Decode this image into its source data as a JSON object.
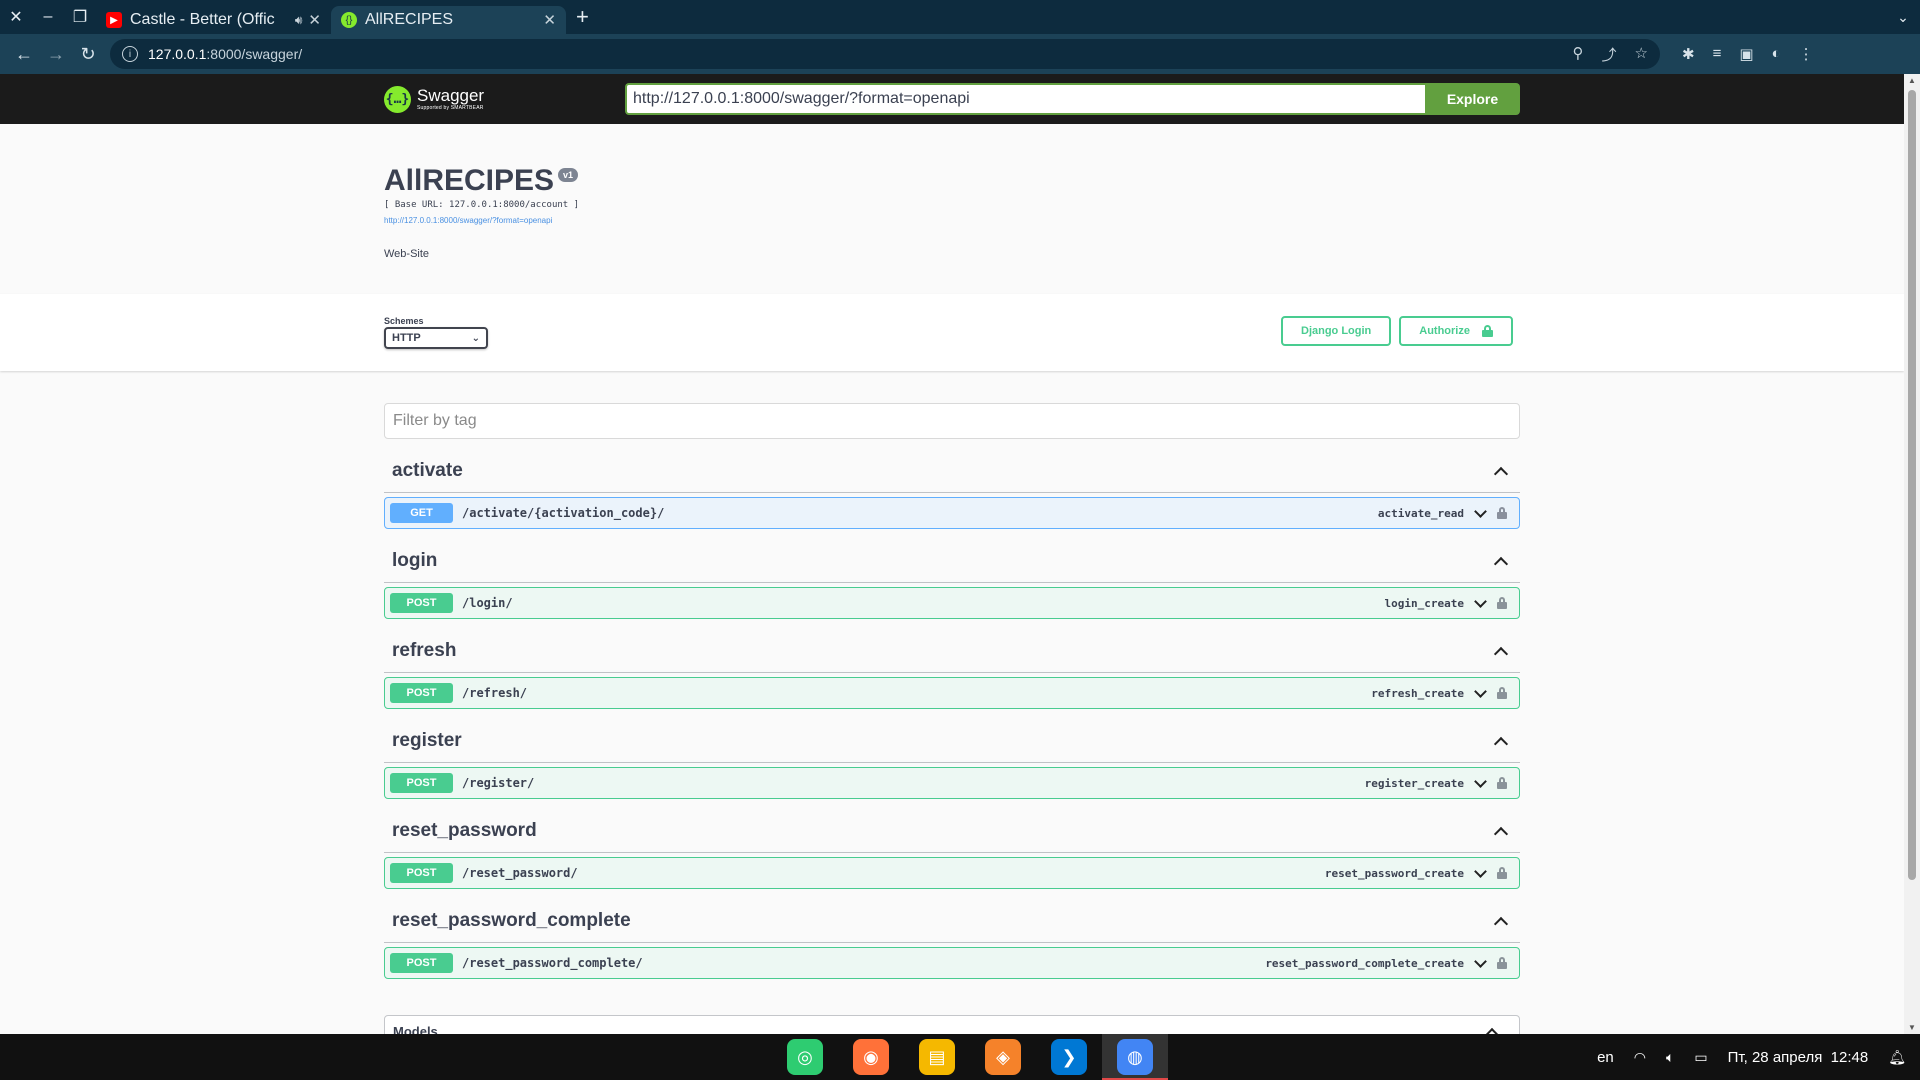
{
  "browser": {
    "tabs": [
      {
        "title": "Castle - Better (Offic",
        "favicon": "youtube-icon",
        "color": "#ff0000",
        "audio": true,
        "active": false
      },
      {
        "title": "AllRECIPES",
        "favicon": "swagger-icon",
        "color": "#85ea2d",
        "audio": false,
        "active": true
      }
    ],
    "url_host": "127.0.0.1",
    "url_rest": ":8000/swagger/"
  },
  "swagger": {
    "logo_word": "Swagger",
    "logo_sub": "Supported by SMARTBEAR",
    "explore_url": "http://127.0.0.1:8000/swagger/?format=openapi",
    "explore_label": "Explore",
    "title": "AllRECIPES",
    "version": "v1",
    "base_url": "[ Base URL: 127.0.0.1:8000/account ]",
    "spec_link": "http://127.0.0.1:8000/swagger/?format=openapi",
    "description": "Web-Site",
    "schemes_label": "Schemes",
    "scheme_value": "HTTP",
    "django_login": "Django Login",
    "authorize": "Authorize",
    "filter_placeholder": "Filter by tag",
    "tags": [
      {
        "name": "activate",
        "op": {
          "method": "GET",
          "path": "/activate/{activation_code}/",
          "id": "activate_read"
        }
      },
      {
        "name": "login",
        "op": {
          "method": "POST",
          "path": "/login/",
          "id": "login_create"
        }
      },
      {
        "name": "refresh",
        "op": {
          "method": "POST",
          "path": "/refresh/",
          "id": "refresh_create"
        }
      },
      {
        "name": "register",
        "op": {
          "method": "POST",
          "path": "/register/",
          "id": "register_create"
        }
      },
      {
        "name": "reset_password",
        "op": {
          "method": "POST",
          "path": "/reset_password/",
          "id": "reset_password_create"
        }
      },
      {
        "name": "reset_password_complete",
        "op": {
          "method": "POST",
          "path": "/reset_password_complete/",
          "id": "reset_password_complete_create"
        }
      }
    ],
    "models_label": "Models"
  },
  "taskbar": {
    "apps": [
      {
        "name": "terminal-app-icon",
        "color": "#2ecc71",
        "active": false
      },
      {
        "name": "firefox-app-icon",
        "color": "#ff7139",
        "active": false
      },
      {
        "name": "notes-app-icon",
        "color": "#f5b800",
        "active": false
      },
      {
        "name": "software-center-app-icon",
        "color": "#f5822a",
        "active": false
      },
      {
        "name": "vscode-app-icon",
        "color": "#0078d4",
        "active": false
      },
      {
        "name": "chrome-app-icon",
        "color": "#4285f4",
        "active": true
      }
    ],
    "lang": "en",
    "datetime": "Пт, 28 апреля  12:48"
  }
}
